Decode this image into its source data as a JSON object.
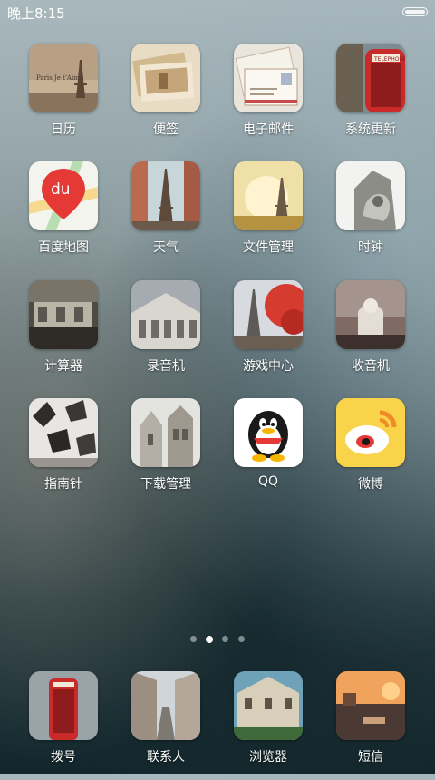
{
  "status_bar": {
    "time": "晚上8:15"
  },
  "apps": [
    {
      "label": "日历",
      "icon": "calendar-eiffel-photo-icon"
    },
    {
      "label": "便签",
      "icon": "notes-postcards-icon"
    },
    {
      "label": "电子邮件",
      "icon": "email-letters-icon"
    },
    {
      "label": "系统更新",
      "icon": "system-update-phonebooth-icon"
    },
    {
      "label": "百度地图",
      "icon": "baidu-map-icon",
      "icon_text": "du"
    },
    {
      "label": "天气",
      "icon": "weather-eiffel-icon"
    },
    {
      "label": "文件管理",
      "icon": "file-manager-eiffel-icon"
    },
    {
      "label": "时钟",
      "icon": "clock-statue-icon"
    },
    {
      "label": "计算器",
      "icon": "calculator-street-icon"
    },
    {
      "label": "录音机",
      "icon": "recorder-building-icon"
    },
    {
      "label": "游戏中心",
      "icon": "game-center-eiffel-icon"
    },
    {
      "label": "收音机",
      "icon": "radio-basilica-icon"
    },
    {
      "label": "指南针",
      "icon": "compass-leaves-icon"
    },
    {
      "label": "下载管理",
      "icon": "download-manager-church-icon"
    },
    {
      "label": "QQ",
      "icon": "qq-penguin-icon"
    },
    {
      "label": "微博",
      "icon": "weibo-icon"
    }
  ],
  "page_indicator": {
    "count": 4,
    "active": 2
  },
  "dock": [
    {
      "label": "拨号",
      "icon": "dialer-phonebooth-icon"
    },
    {
      "label": "联系人",
      "icon": "contacts-street-icon"
    },
    {
      "label": "浏览器",
      "icon": "browser-building-icon"
    },
    {
      "label": "短信",
      "icon": "messages-canal-icon"
    }
  ]
}
